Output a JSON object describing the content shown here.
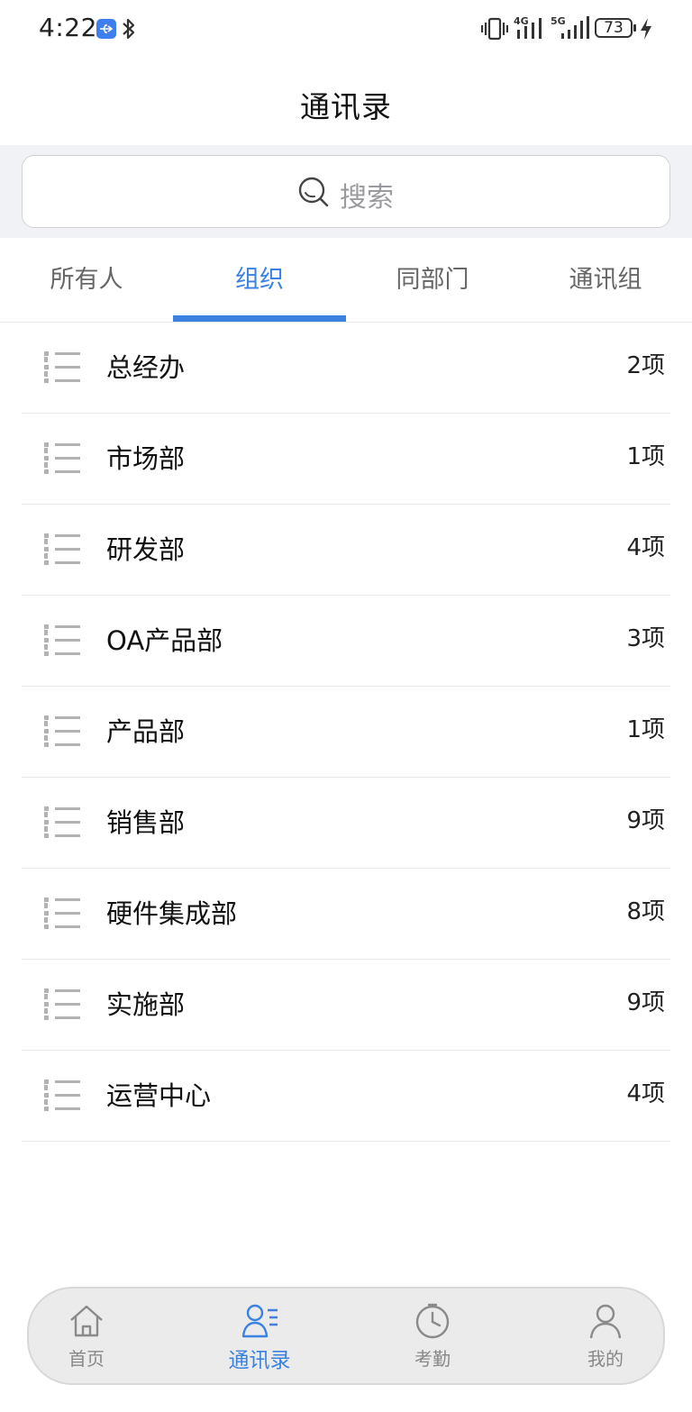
{
  "status_bar": {
    "time": "4:22",
    "network_4g": "4G",
    "network_5g": "5G",
    "battery": "73",
    "icons": [
      "usb-icon",
      "bluetooth-icon",
      "vibrate-icon",
      "signal-icon",
      "battery-icon",
      "charging-icon"
    ]
  },
  "header": {
    "title": "通讯录"
  },
  "search": {
    "placeholder": "搜索"
  },
  "tabs": [
    {
      "label": "所有人",
      "active": false
    },
    {
      "label": "组织",
      "active": true
    },
    {
      "label": "同部门",
      "active": false
    },
    {
      "label": "通讯组",
      "active": false
    }
  ],
  "organizations": [
    {
      "name": "总经办",
      "count": "2项"
    },
    {
      "name": "市场部",
      "count": "1项"
    },
    {
      "name": "研发部",
      "count": "4项"
    },
    {
      "name": "OA产品部",
      "count": "3项"
    },
    {
      "name": "产品部",
      "count": "1项"
    },
    {
      "name": "销售部",
      "count": "9项"
    },
    {
      "name": "硬件集成部",
      "count": "8项"
    },
    {
      "name": "实施部",
      "count": "9项"
    },
    {
      "name": "运营中心",
      "count": "4项"
    }
  ],
  "bottom_nav": [
    {
      "label": "首页",
      "icon": "home-icon",
      "active": false
    },
    {
      "label": "通讯录",
      "icon": "contacts-icon",
      "active": true
    },
    {
      "label": "考勤",
      "icon": "clock-icon",
      "active": false
    },
    {
      "label": "我的",
      "icon": "person-icon",
      "active": false
    }
  ],
  "colors": {
    "accent": "#3b82e0",
    "text": "#111111",
    "muted": "#666666",
    "search_band": "#f1f2f5",
    "divider": "#e8e8ea",
    "nav_bg": "#ebebeb"
  }
}
